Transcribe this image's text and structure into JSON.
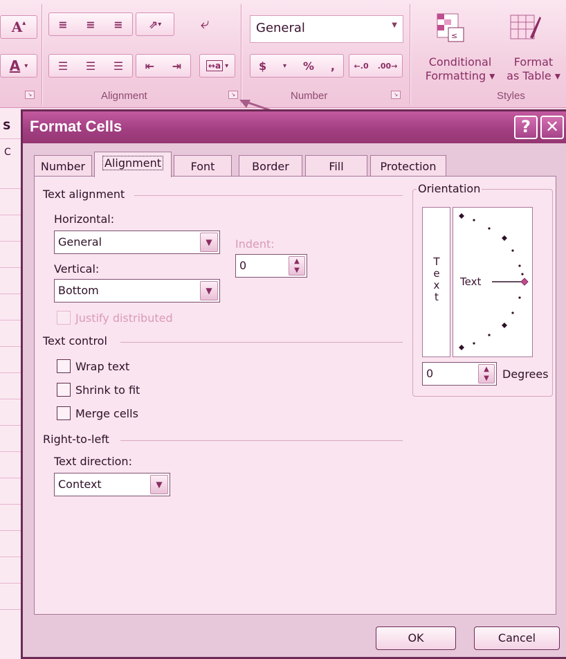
{
  "ribbon": {
    "font_a_large": "A",
    "font_a_color": "A",
    "groups": {
      "alignment_label": "Alignment",
      "number_label": "Number",
      "styles_label": "Styles"
    },
    "number_format": "General",
    "currency": "$",
    "percent": "%",
    "comma": ",",
    "conditional_formatting": [
      "Conditional",
      "Formatting ▾"
    ],
    "format_as_table": [
      "Format",
      "as Table ▾"
    ]
  },
  "sheet": {
    "column_header": "S",
    "row_label": "C"
  },
  "dialog": {
    "title": "Format Cells",
    "help_glyph": "?",
    "close_glyph": "✕",
    "tabs": [
      {
        "label": "Number"
      },
      {
        "label": "Alignment",
        "active": true
      },
      {
        "label": "Font"
      },
      {
        "label": "Border"
      },
      {
        "label": "Fill"
      },
      {
        "label": "Protection"
      }
    ],
    "text_alignment": {
      "section": "Text alignment",
      "horizontal_label": "Horizontal:",
      "horizontal_value": "General",
      "indent_label": "Indent:",
      "indent_value": "0",
      "vertical_label": "Vertical:",
      "vertical_value": "Bottom",
      "justify_distributed": "Justify distributed"
    },
    "text_control": {
      "section": "Text control",
      "wrap_text": "Wrap text",
      "shrink_to_fit": "Shrink to fit",
      "merge_cells": "Merge cells"
    },
    "right_to_left": {
      "section": "Right-to-left",
      "text_direction_label": "Text direction:",
      "text_direction_value": "Context"
    },
    "orientation": {
      "section": "Orientation",
      "vertical_text": [
        "T",
        "e",
        "x",
        "t"
      ],
      "dial_text": "Text",
      "degrees_value": "0",
      "degrees_label": "Degrees"
    },
    "ok_label": "OK",
    "cancel_label": "Cancel"
  },
  "colors": {
    "titlebar": "#a23f82",
    "panel": "#fae4ef",
    "ribbon": "#f3cfe0",
    "accent": "#8a2d63"
  }
}
